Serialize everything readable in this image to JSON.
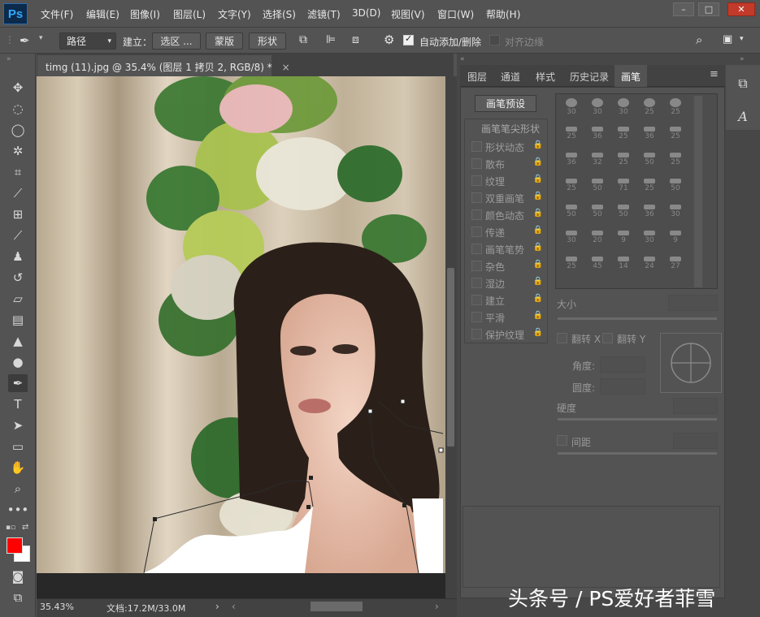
{
  "app": {
    "logo": "Ps",
    "menu": [
      "文件(F)",
      "编辑(E)",
      "图像(I)",
      "图层(L)",
      "文字(Y)",
      "选择(S)",
      "滤镜(T)",
      "3D(D)",
      "视图(V)",
      "窗口(W)",
      "帮助(H)"
    ],
    "window_buttons": [
      "–",
      "□",
      "✕"
    ]
  },
  "options_bar": {
    "mode_value": "路径",
    "make_label": "建立：",
    "selection_button": "选区 ...",
    "mask_button": "蒙版",
    "shape_button": "形状",
    "auto_add_delete_label": "自动添加/删除",
    "auto_add_delete_checked": true,
    "align_edges_label": "对齐边缘",
    "align_edges_checked": false
  },
  "document": {
    "tab_title": "timg (11).jpg @ 35.4% (图层 1 拷贝 2, RGB/8) *",
    "close_glyph": "×"
  },
  "status": {
    "zoom": "35.43%",
    "doc_info": "文档:17.2M/33.0M"
  },
  "tools": [
    "move-icon",
    "marquee-icon",
    "lasso-icon",
    "magic-wand-icon",
    "crop-icon",
    "eyedropper-icon",
    "healing-icon",
    "brush-icon",
    "stamp-icon",
    "history-brush-icon",
    "eraser-icon",
    "gradient-icon",
    "blur-icon",
    "dodge-icon",
    "pen-icon",
    "type-icon",
    "path-select-icon",
    "rectangle-icon",
    "hand-icon",
    "zoom-icon",
    "more-icon"
  ],
  "colors": {
    "foreground": "#ff0000",
    "background": "#ffffff",
    "accent_blue": "#31a8ff"
  },
  "panels": {
    "tabs": [
      "图层",
      "通道",
      "样式",
      "历史记录",
      "画笔"
    ],
    "active_tab": "画笔",
    "brush": {
      "preset_button": "画笔预设",
      "options_header": "画笔笔尖形状",
      "options": [
        "形状动态",
        "散布",
        "纹理",
        "双重画笔",
        "颜色动态",
        "传递",
        "画笔笔势",
        "杂色",
        "湿边",
        "建立",
        "平滑",
        "保护纹理"
      ],
      "tip_sizes": [
        "30",
        "30",
        "30",
        "25",
        "25",
        "25",
        "36",
        "25",
        "36",
        "25",
        "36",
        "32",
        "25",
        "50",
        "25",
        "25",
        "50",
        "71",
        "25",
        "50",
        "50",
        "50",
        "50",
        "36",
        "30",
        "30",
        "20",
        "9",
        "30",
        "9",
        "25",
        "45",
        "14",
        "24",
        "27"
      ],
      "size_label": "大小",
      "flip_x_label": "翻转 X",
      "flip_y_label": "翻转 Y",
      "angle_label": "角度:",
      "roundness_label": "圆度:",
      "hardness_label": "硬度",
      "spacing_label": "间距"
    }
  },
  "watermark": "头条号 / PS爱好者菲雪"
}
